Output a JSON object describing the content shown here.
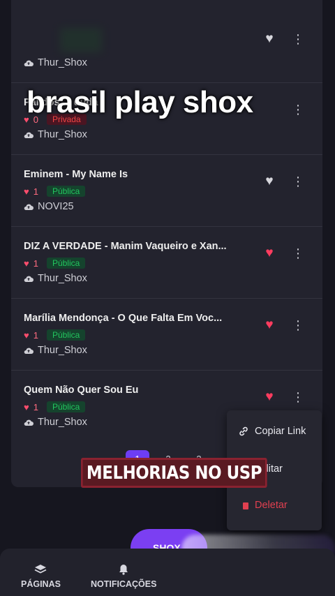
{
  "overlay_title": "brasil play shox",
  "tracks": [
    {
      "title": "",
      "likes": "",
      "visibility": "",
      "uploader": "Thur_Shox",
      "favorited": false
    },
    {
      "title": "Pálidos ... duda",
      "likes": "0",
      "visibility": "Privada",
      "uploader": "Thur_Shox",
      "favorited": false
    },
    {
      "title": "Eminem - My Name Is",
      "likes": "1",
      "visibility": "Pública",
      "uploader": "NOVI25",
      "favorited": false
    },
    {
      "title": "DIZ A VERDADE - Manim Vaqueiro e Xan...",
      "likes": "1",
      "visibility": "Pública",
      "uploader": "Thur_Shox",
      "favorited": true
    },
    {
      "title": "Marília Mendonça - O Que Falta Em Voc...",
      "likes": "1",
      "visibility": "Pública",
      "uploader": "Thur_Shox",
      "favorited": true
    },
    {
      "title": "Quem Não Quer Sou Eu",
      "likes": "1",
      "visibility": "Pública",
      "uploader": "Thur_Shox",
      "favorited": true
    }
  ],
  "pagination": {
    "pages": [
      "1",
      "2",
      "3"
    ],
    "active": "1"
  },
  "context_menu": {
    "copy_link": "Copiar Link",
    "edit": "Editar",
    "delete": "Deletar"
  },
  "caption": "MELHORIAS NO USP",
  "fab_label": "SHOX",
  "bottom_nav": {
    "pages": "PÁGINAS",
    "notifications": "NOTIFICAÇÕES"
  },
  "colors": {
    "accent": "#7b3ff2",
    "heart": "#ff3c5f",
    "public_badge": "#22c55e",
    "private_badge": "#ef4444"
  }
}
